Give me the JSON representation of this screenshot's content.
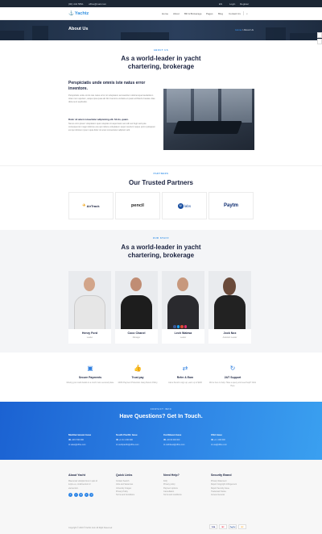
{
  "topbar": {
    "phone": "(00) 444 5891",
    "email": "office@mail.com",
    "lang": "EN",
    "login": "Login",
    "register": "Register"
  },
  "nav": {
    "logo": "Yachtz",
    "items": [
      "Home",
      "About",
      "Bill & Brokerage",
      "Pages",
      "Blog",
      "Contact Us"
    ]
  },
  "hero": {
    "title": "About Us",
    "crumb_home": "Home",
    "crumb_current": "About Us"
  },
  "about": {
    "eyebrow": "ABOUT US",
    "title": "As a world-leader in yacht chartering, brokerage",
    "subtitle": "Perspiciatis unde omnis iste natus error inventore.",
    "p1": "Perspiciatis unde omnis iste natus error sit voluptatem accusantium doloremque laudantium totam rem aperiam, eaque ipsa quae ab illo inventore veritatis et quasi architecto beatae vitae dicta sunt explicabo.",
    "question": "Dolor sit amet consectetur adipisicing elit. Sit do, quam.",
    "p2": "Nemo enim ipsam voluptatem quia voluptas sit aspernatur aut odit aut fugit sed quia consequuntur magni dolores eos qui ratione voluptatem sequi nesciunt neque porro quisquam est qui dolorem ipsum quia dolor sit amet consectetur adipisci velit."
  },
  "partners": {
    "eyebrow": "PARTNERS",
    "title": "Our Trusted Partners",
    "logos": [
      "AirTrack",
      "pencil",
      "labs",
      "Paytm"
    ]
  },
  "staff": {
    "eyebrow": "OUR STAFF",
    "title": "As a world-leader in yacht chartering, brokerage",
    "members": [
      {
        "name": "Henry Ford",
        "role": "Leader"
      },
      {
        "name": "Coco Chanel",
        "role": "Manager"
      },
      {
        "name": "Lech Walesa",
        "role": "Leader"
      },
      {
        "name": "Jock Nox",
        "role": "Assistant Leader"
      }
    ]
  },
  "features": [
    {
      "icon": "wallet-icon",
      "title": "Secure Payments",
      "desc": "Moving your card details to a much more secured place"
    },
    {
      "icon": "thumbs-up-icon",
      "title": "Trust pay",
      "desc": "100% Payment Protection. Easy Return Policy"
    },
    {
      "icon": "exchange-icon",
      "title": "Refer & Earn",
      "desc": "Ask a friend to sign up, earn up to $100"
    },
    {
      "icon": "support-icon",
      "title": "24/7 Support",
      "desc": "We're here to help. Have a query and need help? Click Here"
    }
  ],
  "contact": {
    "eyebrow": "CONTACT INFO",
    "title": "Have Questions? Get In Touch.",
    "offices": [
      {
        "name": "Mediterranean base",
        "phone": "+38 0 500 000",
        "email": "sales@office.com"
      },
      {
        "name": "South Pacific base",
        "phone": "+1 01 1 000 000",
        "email": "southpacific@office.com"
      },
      {
        "name": "Caribbean base",
        "phone": "+30 00 000 000",
        "email": "caribbean@office.com"
      },
      {
        "name": "USA base",
        "phone": "+1 1 000 000",
        "email": "usa@office.com"
      }
    ]
  },
  "footer": {
    "about_title": "About Yacht",
    "about_text": [
      "Maecenas volutpat risus in quis id",
      "turpis eu, condimentum id",
      "elementum."
    ],
    "quick_title": "Quick Links",
    "quick_links": [
      "Contact Search",
      "Jobs and Vacancies",
      "University Images",
      "Privacy Policy",
      "Terms and Conditions"
    ],
    "help_title": "Need Help?",
    "help_links": [
      "FAQ",
      "Privacy policy",
      "Payment options",
      "Cancellation",
      "Terms and conditions"
    ],
    "security_title": "Security Brand",
    "security_links": [
      "Privacy Statement",
      "Report Copyright Infringement",
      "Report Security Issue",
      "Trademark Notice",
      "Access General"
    ],
    "copyright": "Copyright © 2019 ©Yachtz.Com All Right Reserved",
    "payments": [
      "VISA",
      "MC",
      "PayPal",
      "MC"
    ]
  },
  "colors": {
    "accent": "#2f86e6",
    "dark": "#1b2340",
    "topbar": "#1c2734"
  }
}
